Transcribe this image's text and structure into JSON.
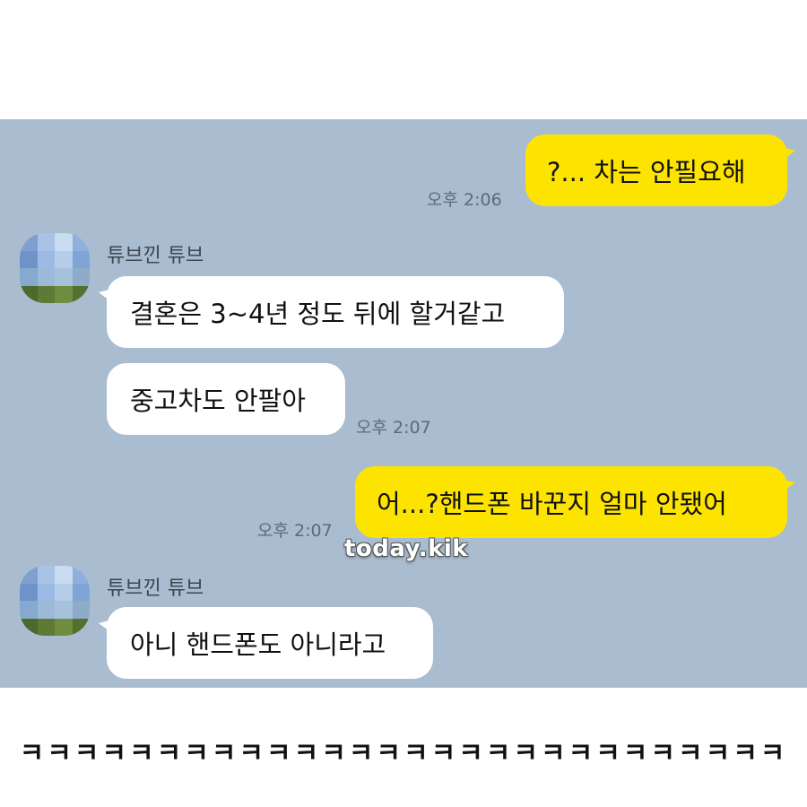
{
  "chat": {
    "messages": [
      {
        "sender": "me",
        "text": "?... 차는 안필요해",
        "time": "오후 2:06"
      },
      {
        "sender": "튜브낀 튜브",
        "text": "결혼은 3~4년 정도 뒤에 할거같고"
      },
      {
        "sender": "튜브낀 튜브",
        "text": "중고차도 안팔아",
        "time": "오후 2:07"
      },
      {
        "sender": "me",
        "text": "어...?핸드폰 바꾼지 얼마 안됐어",
        "time": "오후 2:07"
      },
      {
        "sender": "튜브낀 튜브",
        "text": "아니 핸드폰도 아니라고"
      }
    ],
    "contact_name": "튜브낀 튜브"
  },
  "watermark": "today.kik",
  "caption": "ㅋㅋㅋㅋㅋㅋㅋㅋㅋㅋㅋㅋㅋㅋㅋㅋㅋㅋㅋㅋㅋㅋㅋㅋㅋㅋㅋㅋ",
  "colors": {
    "chat_background": "#a9bcd0",
    "my_bubble": "#fde400",
    "their_bubble": "#ffffff"
  }
}
